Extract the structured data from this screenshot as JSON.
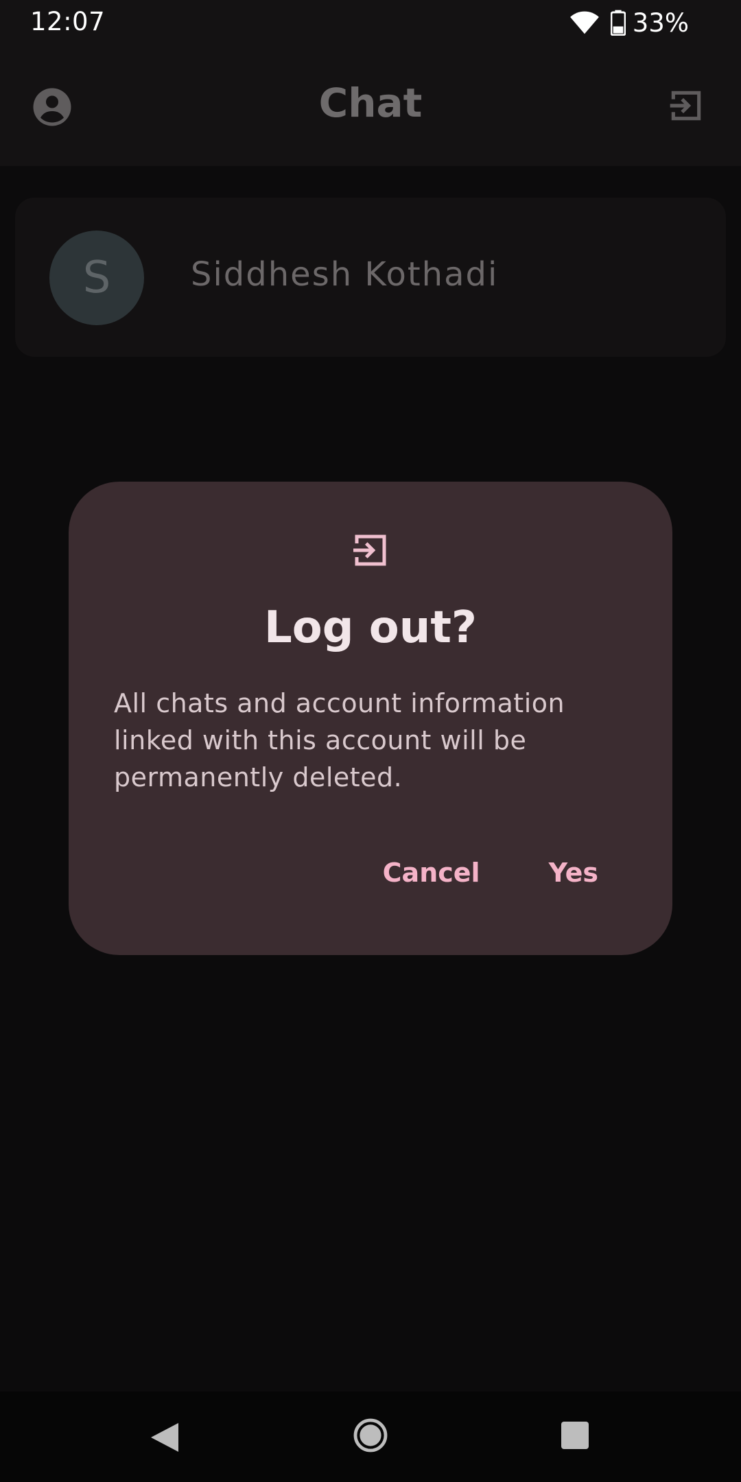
{
  "status_bar": {
    "time": "12:07",
    "battery": "33%",
    "icons": [
      "wifi-icon",
      "battery-icon"
    ]
  },
  "app_bar": {
    "title": "Chat",
    "left_icon": "account-circle-icon",
    "right_icon": "logout-icon"
  },
  "chat_list": {
    "items": [
      {
        "avatar_letter": "S",
        "name": "Siddhesh Kothadi"
      }
    ]
  },
  "dialog": {
    "icon": "logout-icon",
    "title": "Log out?",
    "body": "All chats and account information linked with this account will be permanently deleted.",
    "cancel_label": "Cancel",
    "confirm_label": "Yes"
  },
  "nav_bar": {
    "buttons": [
      "back-icon",
      "home-icon",
      "recents-icon"
    ]
  },
  "colors": {
    "background": "#0c0b0c",
    "dialog_bg": "#3b2c30",
    "accent": "#f5b3c8",
    "title_text": "#f2e6e9"
  }
}
